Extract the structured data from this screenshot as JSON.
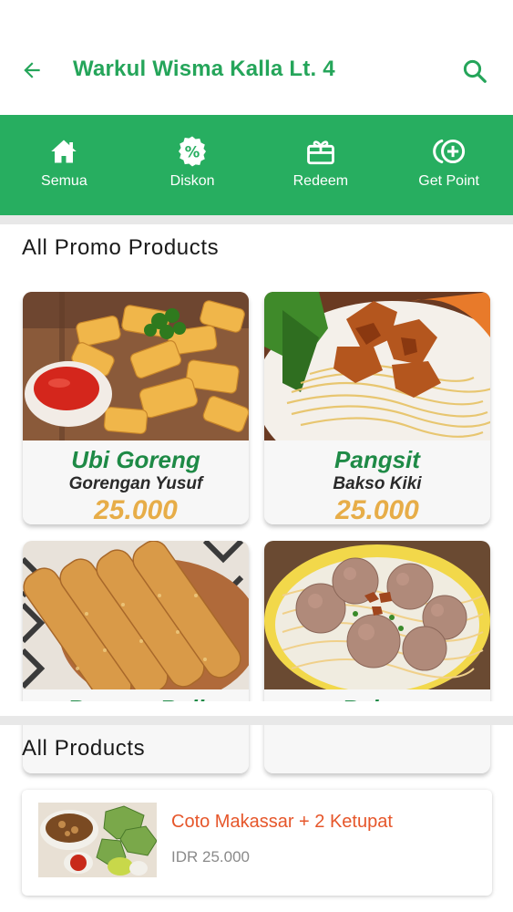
{
  "header": {
    "title": "Warkul Wisma Kalla Lt. 4",
    "back_icon": "arrow-left-icon",
    "search_icon": "search-icon",
    "accent_color": "#25a55a"
  },
  "menu": {
    "background_color": "#27ae60",
    "items": [
      {
        "label": "Semua",
        "icon": "home-icon"
      },
      {
        "label": "Diskon",
        "icon": "discount-badge-icon"
      },
      {
        "label": "Redeem",
        "icon": "gift-icon"
      },
      {
        "label": "Get Point",
        "icon": "add-point-icon"
      }
    ]
  },
  "promo": {
    "title": "All Promo Products",
    "items": [
      {
        "name": "Ubi Goreng",
        "store": "Gorengan Yusuf",
        "price": "25.000"
      },
      {
        "name": "Pangsit",
        "store": "Bakso Kiki",
        "price": "25.000"
      },
      {
        "name": "Banana Roll",
        "store": "",
        "price": ""
      },
      {
        "name": "Bakso",
        "store": "",
        "price": ""
      }
    ]
  },
  "products": {
    "title": "All Products",
    "items": [
      {
        "name": "Coto Makassar + 2 Ketupat",
        "price": "IDR 25.000"
      }
    ]
  }
}
